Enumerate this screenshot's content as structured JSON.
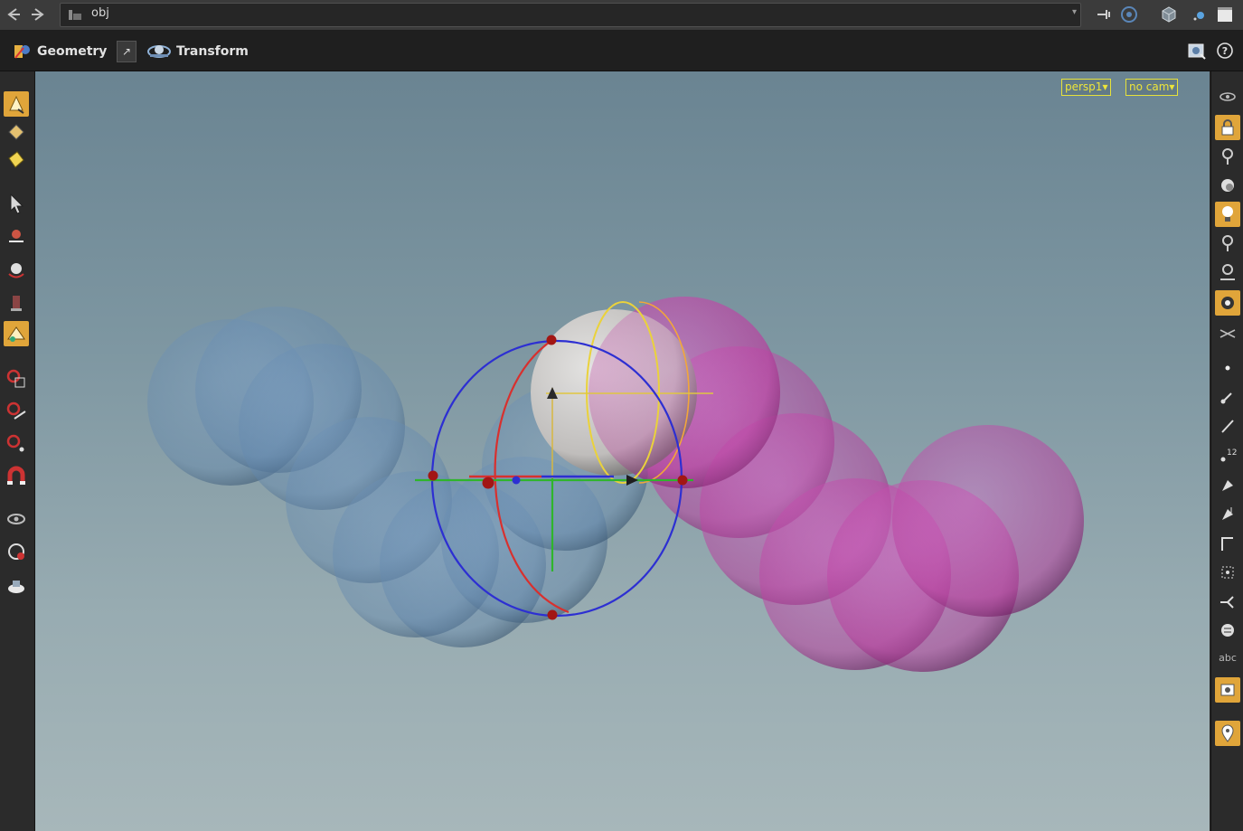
{
  "topbar": {
    "back_icon": "back-arrow-icon",
    "forward_icon": "forward-arrow-icon",
    "path": "obj",
    "path_dropdown": "▾"
  },
  "shelf": {
    "geometry_label": "Geometry",
    "transform_label": "Transform",
    "separator_glyph": "↗"
  },
  "viewport": {
    "camera_label": "persp1▾",
    "cam_label": "no cam▾"
  },
  "righttool": {
    "abc_label": "abc",
    "num_label": "12"
  },
  "colors": {
    "accent": "#e0a53a",
    "overlay_label": "#ece53a",
    "blue_spheres": "#6f93b8",
    "pink_spheres": "#c44ab8"
  }
}
